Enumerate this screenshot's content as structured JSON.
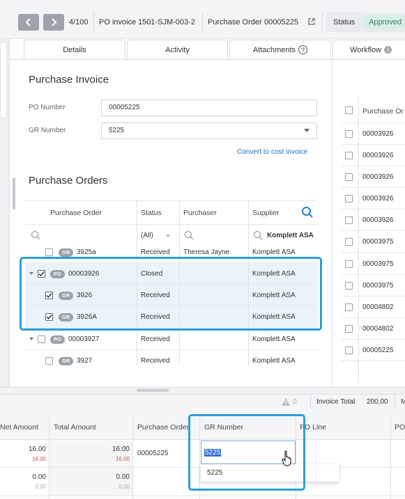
{
  "topbar": {
    "record_counter": "4/100",
    "po_invoice_label": "PO invoice",
    "po_invoice_value": "1501-SJM-003-2",
    "purchase_order_label": "Purchase Order",
    "purchase_order_value": "00005225",
    "status_label": "Status",
    "status_value": "Approved"
  },
  "tabs": [
    {
      "label": "Details"
    },
    {
      "label": "Activity"
    },
    {
      "label": "Attachments"
    },
    {
      "label": "Workflow"
    }
  ],
  "purchase_invoice": {
    "title": "Purchase Invoice",
    "po_number_label": "PO Number",
    "po_number_value": "00005225",
    "gr_number_label": "GR Number",
    "gr_number_value": "5225",
    "convert_link": "Convert to cost invoice"
  },
  "purchase_orders": {
    "title": "Purchase Orders",
    "columns": [
      "Purchase Order",
      "Status",
      "Purchaser",
      "Supplier"
    ],
    "filter_status": "(All)",
    "filter_supplier": "Komplett ASA",
    "rows": [
      {
        "type": "GR",
        "id": "3925a",
        "status": "Received",
        "purchaser": "Theresa Jayne",
        "supplier": "Komplett ASA",
        "checked": false,
        "level": 1
      },
      {
        "type": "PO",
        "id": "00003926",
        "status": "Closed",
        "purchaser": "",
        "supplier": "Komplett ASA",
        "checked": true,
        "level": 0
      },
      {
        "type": "GR",
        "id": "3926",
        "status": "Received",
        "purchaser": "",
        "supplier": "Komplett ASA",
        "checked": true,
        "level": 1
      },
      {
        "type": "GR",
        "id": "3926A",
        "status": "Received",
        "purchaser": "",
        "supplier": "Komplett ASA",
        "checked": true,
        "level": 1
      },
      {
        "type": "PO",
        "id": "00003927",
        "status": "Received",
        "purchaser": "",
        "supplier": "Komplett ASA",
        "checked": false,
        "level": 0
      },
      {
        "type": "GR",
        "id": "3927",
        "status": "Received",
        "purchaser": "",
        "supplier": "Komplett ASA",
        "checked": false,
        "level": 1
      }
    ]
  },
  "right_panel": {
    "header": "Purchase Or",
    "rows": [
      "00003926",
      "00003926",
      "00003926",
      "00003926",
      "00003926",
      "00003975",
      "00003975",
      "00003975",
      "00004802",
      "00004802",
      "00005225"
    ]
  },
  "summary": {
    "warning_count": "0",
    "invoice_total_label": "Invoice Total",
    "invoice_total_value": "200,00",
    "trailing": "M"
  },
  "lines_table": {
    "columns": [
      "Net Amount",
      "Total Amount",
      "Purchase Order",
      "GR Number",
      "PO Line",
      "PO"
    ],
    "rows": [
      {
        "net": "16.00",
        "net_sub": "16.00",
        "total": "16.00",
        "total_sub": "16.00",
        "purchase_order": "00005225",
        "gr_number": "5225"
      },
      {
        "net": "0.00",
        "net_sub": "0.00",
        "total": "0.00",
        "total_sub": "0.00",
        "purchase_order": "",
        "gr_number": ""
      }
    ],
    "dropdown_option": "5225"
  },
  "colors": {
    "highlight": "#2a9fd8",
    "approved_bg": "#d8efe6",
    "link": "#1f6fb8"
  }
}
